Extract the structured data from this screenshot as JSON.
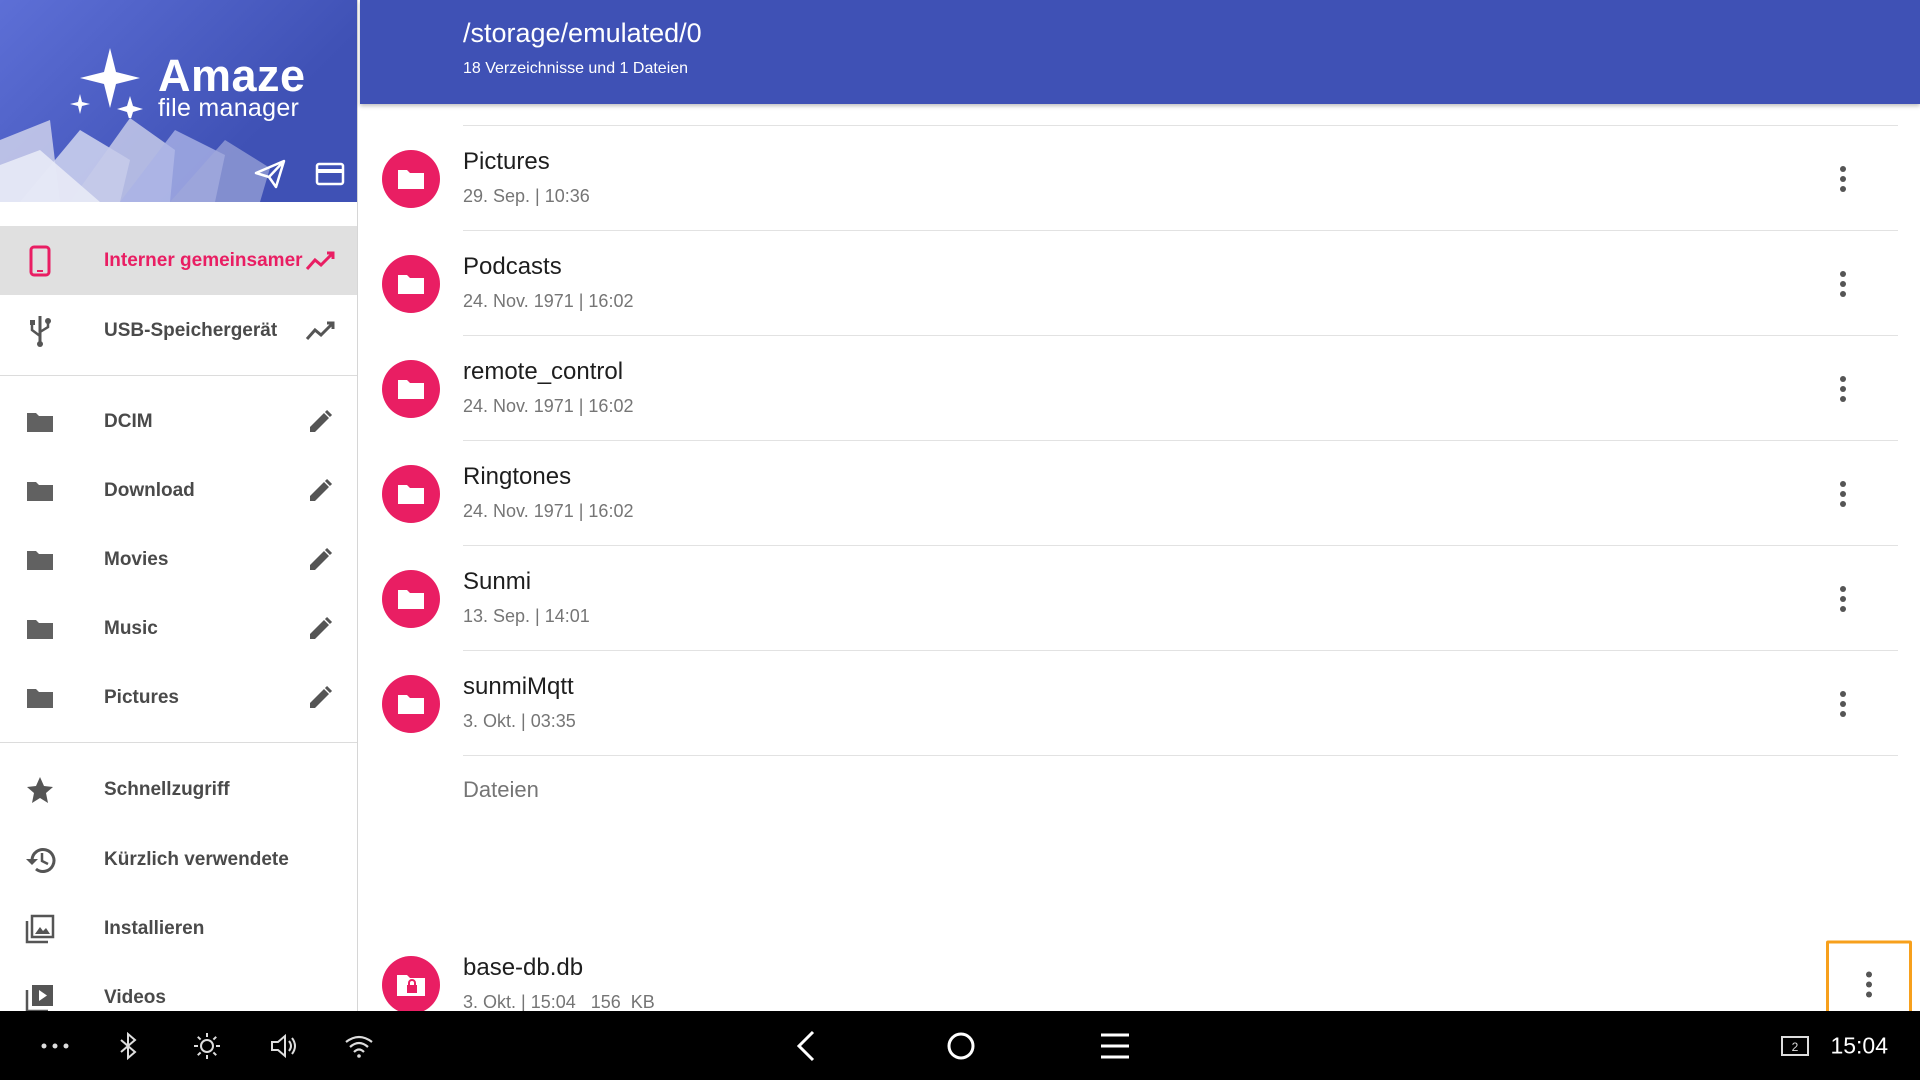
{
  "app": {
    "name": "Amaze",
    "subtitle": "file manager"
  },
  "sidebar": {
    "storage": [
      {
        "label": "Interner gemeinsamer",
        "icon": "phone-icon",
        "trail_icon": "usage-trend-icon",
        "active": true
      },
      {
        "label": "USB-Speichergerät",
        "icon": "usb-icon",
        "trail_icon": "usage-trend-icon",
        "active": false
      }
    ],
    "bookmarks": [
      {
        "label": "DCIM",
        "icon": "folder-icon",
        "trail_icon": "pencil-icon"
      },
      {
        "label": "Download",
        "icon": "folder-icon",
        "trail_icon": "pencil-icon"
      },
      {
        "label": "Movies",
        "icon": "folder-icon",
        "trail_icon": "pencil-icon"
      },
      {
        "label": "Music",
        "icon": "folder-icon",
        "trail_icon": "pencil-icon"
      },
      {
        "label": "Pictures",
        "icon": "folder-icon",
        "trail_icon": "pencil-icon"
      }
    ],
    "quick": [
      {
        "label": "Schnellzugriff",
        "icon": "star-icon"
      },
      {
        "label": "Kürzlich verwendete",
        "icon": "history-icon"
      },
      {
        "label": "Installieren",
        "icon": "images-icon"
      },
      {
        "label": "Videos",
        "icon": "video-library-icon"
      }
    ]
  },
  "header": {
    "path": "/storage/emulated/0",
    "summary": "18 Verzeichnisse und 1 Dateien"
  },
  "folders": [
    {
      "name": "Pictures",
      "meta": "29. Sep. | 10:36"
    },
    {
      "name": "Podcasts",
      "meta": "24. Nov. 1971 | 16:02"
    },
    {
      "name": "remote_control",
      "meta": "24. Nov. 1971 | 16:02"
    },
    {
      "name": "Ringtones",
      "meta": "24. Nov. 1971 | 16:02"
    },
    {
      "name": "Sunmi",
      "meta": "13. Sep. | 14:01"
    },
    {
      "name": "sunmiMqtt",
      "meta": "3. Okt. | 03:35"
    }
  ],
  "files_section_label": "Dateien",
  "files": [
    {
      "name": "base-db.db",
      "meta": "3. Okt. | 15:04   156  KB",
      "icon": "locked-file-icon"
    }
  ],
  "system_bar": {
    "time": "15:04",
    "screen_badge": "2"
  },
  "colors": {
    "primary": "#3f51b5",
    "accent": "#e91e63",
    "focus_outline": "#f7a01c"
  }
}
